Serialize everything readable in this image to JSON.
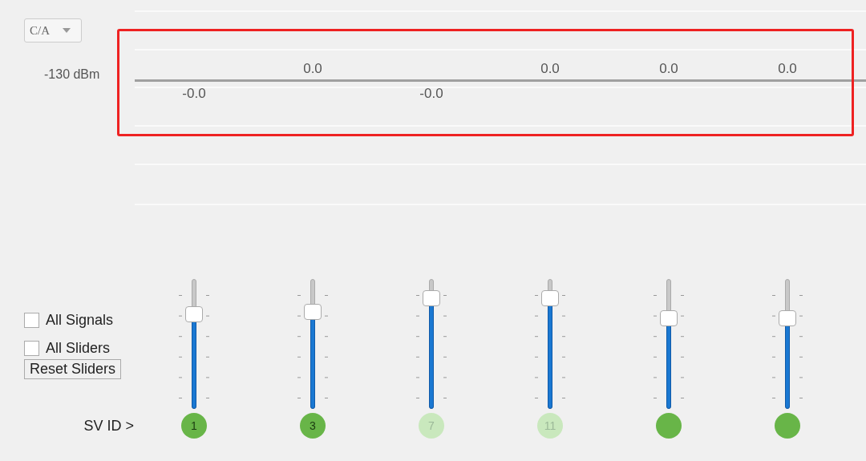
{
  "mode_dropdown": {
    "value": "C/A"
  },
  "chart": {
    "axis_label": "-130 dBm",
    "highlighted": true,
    "readings": [
      {
        "text": "-0.0",
        "kind": "below"
      },
      {
        "text": "0.0",
        "kind": "above"
      },
      {
        "text": "-0.0",
        "kind": "below"
      },
      {
        "text": "0.0",
        "kind": "above"
      },
      {
        "text": "0.0",
        "kind": "above"
      },
      {
        "text": "0.0",
        "kind": "above"
      }
    ]
  },
  "controls": {
    "checkboxes": [
      {
        "label": "All Signals",
        "checked": false
      },
      {
        "label": "All Sliders",
        "checked": false
      }
    ],
    "reset_button": "Reset Sliders",
    "sv_id_label": "SV ID >"
  },
  "satellites": [
    {
      "sv_id": "1",
      "active": true,
      "level": 0.73
    },
    {
      "sv_id": "3",
      "active": true,
      "level": 0.75
    },
    {
      "sv_id": "7",
      "active": false,
      "level": 0.85
    },
    {
      "sv_id": "11",
      "active": false,
      "level": 0.85
    },
    {
      "active": true,
      "level": 0.7
    },
    {
      "active": true,
      "level": 0.7
    }
  ]
}
